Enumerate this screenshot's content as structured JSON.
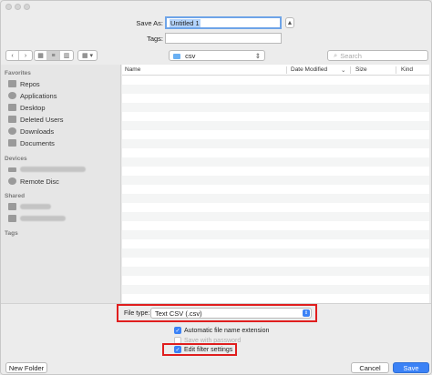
{
  "dialog": {
    "save_as_label": "Save As:",
    "save_as_value": "Untitled 1",
    "tags_label": "Tags:",
    "tags_value": ""
  },
  "toolbar": {
    "back_icon": "chevron-left-icon",
    "forward_icon": "chevron-right-icon",
    "location_value": "csv",
    "search_placeholder": "Search"
  },
  "sidebar": {
    "favorites_header": "Favorites",
    "favorites": [
      {
        "label": "Repos",
        "icon": "folder-icon"
      },
      {
        "label": "Applications",
        "icon": "applications-icon"
      },
      {
        "label": "Desktop",
        "icon": "desktop-icon"
      },
      {
        "label": "Deleted Users",
        "icon": "folder-icon"
      },
      {
        "label": "Downloads",
        "icon": "downloads-icon"
      },
      {
        "label": "Documents",
        "icon": "documents-icon"
      }
    ],
    "devices_header": "Devices",
    "devices": [
      {
        "label": "Remote Disc",
        "icon": "disc-icon"
      }
    ],
    "shared_header": "Shared",
    "tags_header": "Tags"
  },
  "file_list": {
    "columns": [
      "Name",
      "Date Modified",
      "Size",
      "Kind"
    ]
  },
  "options": {
    "file_type_label": "File type:",
    "file_type_value": "Text CSV (.csv)",
    "auto_extension_label": "Automatic file name extension",
    "save_password_label": "Save with password",
    "edit_filter_label": "Edit filter settings"
  },
  "buttons": {
    "new_folder": "New Folder",
    "cancel": "Cancel",
    "save": "Save"
  },
  "colors": {
    "accent": "#3b82f6",
    "highlight_box": "#e01e1e"
  }
}
